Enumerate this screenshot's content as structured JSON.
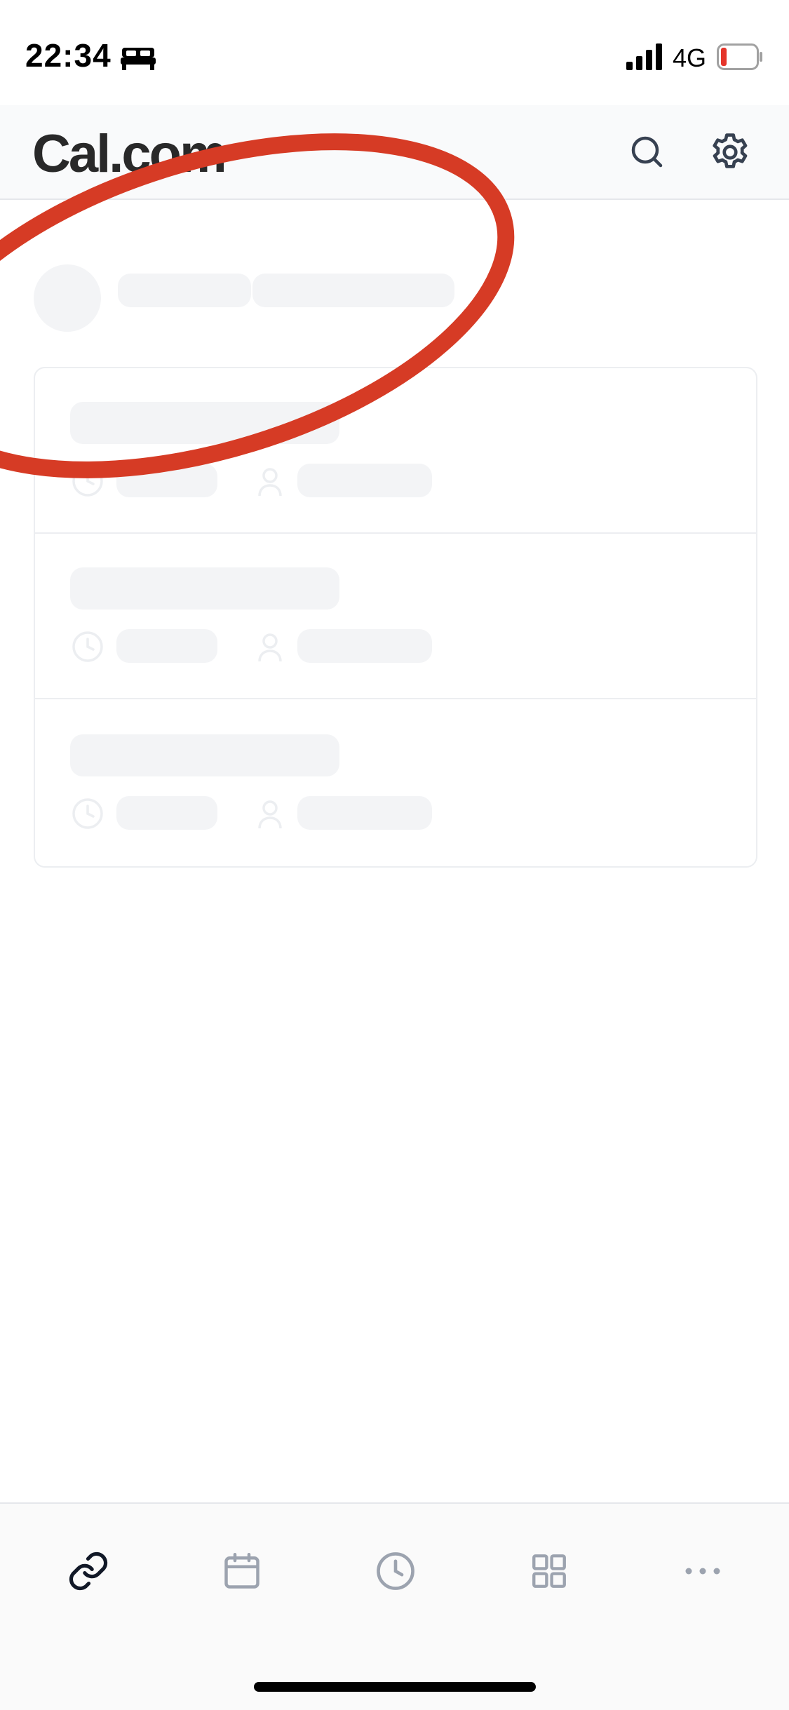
{
  "status_bar": {
    "time": "22:34",
    "network": "4G",
    "battery_color": "#e5352b"
  },
  "header": {
    "logo": "Cal.com",
    "search_icon": "search-icon",
    "settings_icon": "gear-icon"
  },
  "loading": {
    "state": "skeleton",
    "rows": 3
  },
  "bottom_nav": {
    "items": [
      {
        "icon": "link-icon",
        "active": true
      },
      {
        "icon": "calendar-icon",
        "active": false
      },
      {
        "icon": "clock-icon",
        "active": false
      },
      {
        "icon": "grid-icon",
        "active": false
      },
      {
        "icon": "more-icon",
        "active": false
      }
    ]
  },
  "annotation": {
    "type": "ellipse",
    "color": "#d63b25"
  }
}
